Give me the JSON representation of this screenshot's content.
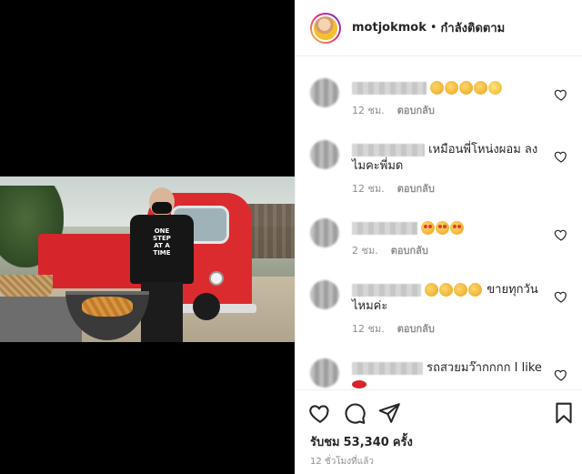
{
  "header": {
    "username": "motjokmok",
    "separator": "•",
    "follow_status": "กำลังติดตาม"
  },
  "video": {
    "shirt_print": "ONE STEP AT A TIME"
  },
  "comments": [
    {
      "text": "",
      "emojis": [
        "clap",
        "clap",
        "clap",
        "clap",
        "smile"
      ],
      "time": "12 ชม.",
      "reply": "ตอบกลับ"
    },
    {
      "text": "เหมือนพี่โหน่งผอม ลงไมคะพี่มด",
      "emojis": [],
      "time": "12 ชม.",
      "reply": "ตอบกลับ"
    },
    {
      "text": "",
      "emojis": [
        "hearteyes",
        "hearteyes",
        "hearteyes"
      ],
      "time": "2 ชม.",
      "reply": "ตอบกลับ"
    },
    {
      "text": "ขายทุกวันไหมค่ะ",
      "emojis": [
        "clap",
        "clap",
        "clap",
        "clap"
      ],
      "time": "12 ชม.",
      "reply": "ตอบกลับ"
    },
    {
      "text": "รถสวยมว๊ากกกก I like",
      "emojis": [
        "lips"
      ],
      "time": "",
      "reply": ""
    }
  ],
  "actions": {
    "views_label": "รับชม",
    "views_count": "53,340",
    "views_unit": "ครั้ง",
    "time_ago": "12 ชั่วโมงที่แล้ว"
  }
}
